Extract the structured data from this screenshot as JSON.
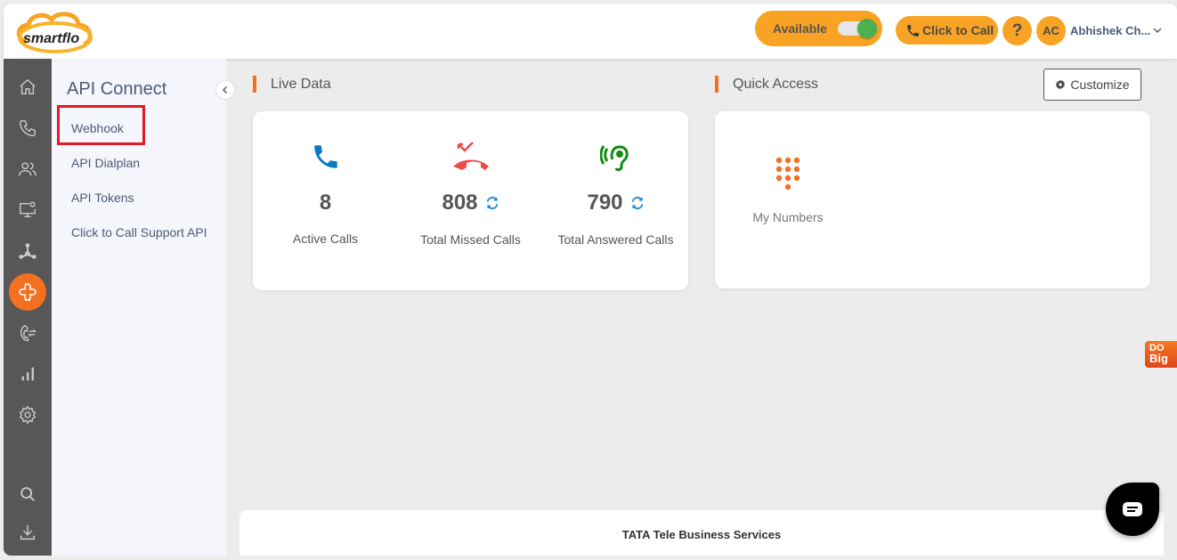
{
  "header": {
    "logo_text": "smartflo",
    "availability_label": "Available",
    "availability_on": true,
    "click_to_call_label": "Click to Call",
    "help_label": "?",
    "user_initials": "AC",
    "user_name": "Abhishek Ch..."
  },
  "rail": {
    "items": [
      {
        "icon": "home-icon"
      },
      {
        "icon": "phone-icon"
      },
      {
        "icon": "users-icon"
      },
      {
        "icon": "monitor-settings-icon"
      },
      {
        "icon": "network-icon"
      },
      {
        "icon": "api-connect-icon",
        "active": true
      },
      {
        "icon": "call-transfer-icon"
      },
      {
        "icon": "analytics-icon"
      },
      {
        "icon": "settings-icon"
      },
      {
        "icon": "search-icon"
      },
      {
        "icon": "download-icon"
      }
    ]
  },
  "subnav": {
    "title": "API Connect",
    "items": [
      {
        "label": "Webhook",
        "highlighted": true
      },
      {
        "label": "API Dialplan"
      },
      {
        "label": "API Tokens"
      },
      {
        "label": "Click to Call Support API"
      }
    ]
  },
  "live_data": {
    "title": "Live Data",
    "stats": [
      {
        "value": "8",
        "label": "Active Calls",
        "color": "#0a7ac4"
      },
      {
        "value": "808",
        "label": "Total Missed Calls",
        "color": "#ee4c4c",
        "refresh": true
      },
      {
        "value": "790",
        "label": "Total Answered Calls",
        "color": "#138a13",
        "refresh": true
      }
    ]
  },
  "quick_access": {
    "title": "Quick Access",
    "customize_label": "Customize",
    "items": [
      {
        "label": "My Numbers",
        "icon": "dialpad-icon"
      }
    ]
  },
  "footer": {
    "text": "TATA Tele Business Services"
  },
  "badge": {
    "line1": "DO",
    "line2": "Big"
  },
  "colors": {
    "accent": "#f9a325",
    "brand_orange": "#f37021",
    "highlight": "#e3192a"
  }
}
